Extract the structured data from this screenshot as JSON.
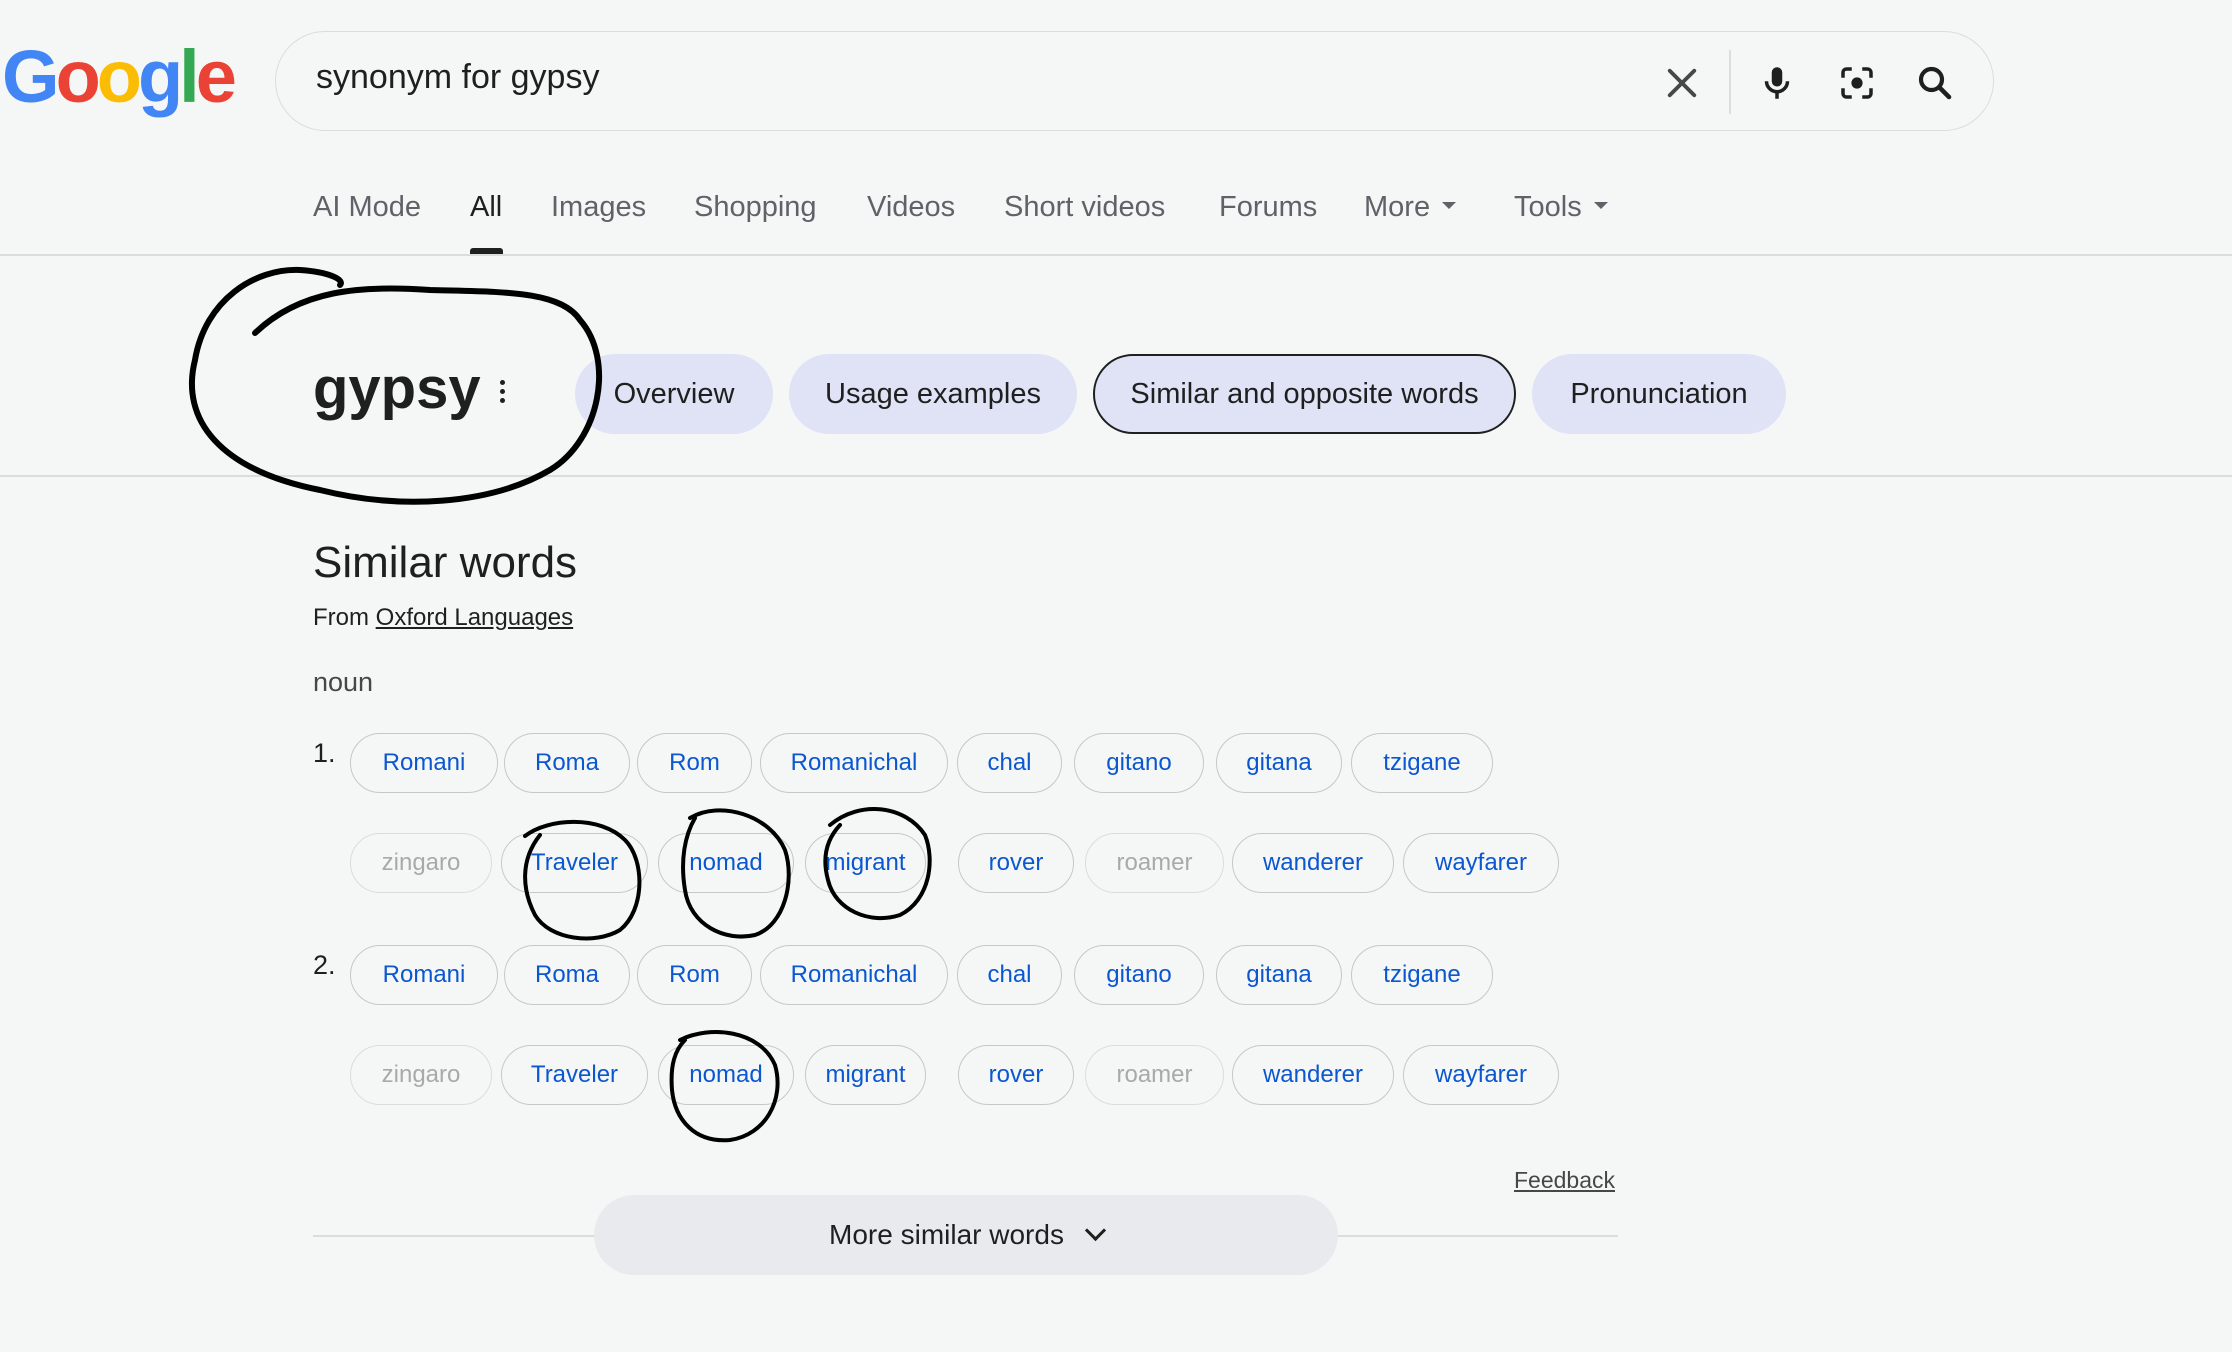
{
  "search": {
    "query": "synonym for gypsy"
  },
  "nav_tabs": [
    {
      "label": "AI Mode"
    },
    {
      "label": "All"
    },
    {
      "label": "Images"
    },
    {
      "label": "Shopping"
    },
    {
      "label": "Videos"
    },
    {
      "label": "Short videos"
    },
    {
      "label": "Forums"
    },
    {
      "label": "More"
    },
    {
      "label": "Tools"
    }
  ],
  "word": "gypsy",
  "section_pills": [
    {
      "label": "Overview"
    },
    {
      "label": "Usage examples"
    },
    {
      "label": "Similar and opposite words"
    },
    {
      "label": "Pronunciation"
    }
  ],
  "similar": {
    "title": "Similar words",
    "from_prefix": "From",
    "source": "Oxford Languages",
    "part_of_speech": "noun",
    "senses": [
      {
        "number": "1.",
        "row1": [
          "Romani",
          "Roma",
          "Rom",
          "Romanichal",
          "chal",
          "gitano",
          "gitana",
          "tzigane"
        ],
        "row2": [
          "zingaro",
          "Traveler",
          "nomad",
          "migrant",
          "rover",
          "roamer",
          "wanderer",
          "wayfarer"
        ]
      },
      {
        "number": "2.",
        "row1": [
          "Romani",
          "Roma",
          "Rom",
          "Romanichal",
          "chal",
          "gitano",
          "gitana",
          "tzigane"
        ],
        "row2": [
          "zingaro",
          "Traveler",
          "nomad",
          "migrant",
          "rover",
          "roamer",
          "wanderer",
          "wayfarer"
        ]
      }
    ],
    "feedback": "Feedback",
    "more_button": "More similar words"
  }
}
